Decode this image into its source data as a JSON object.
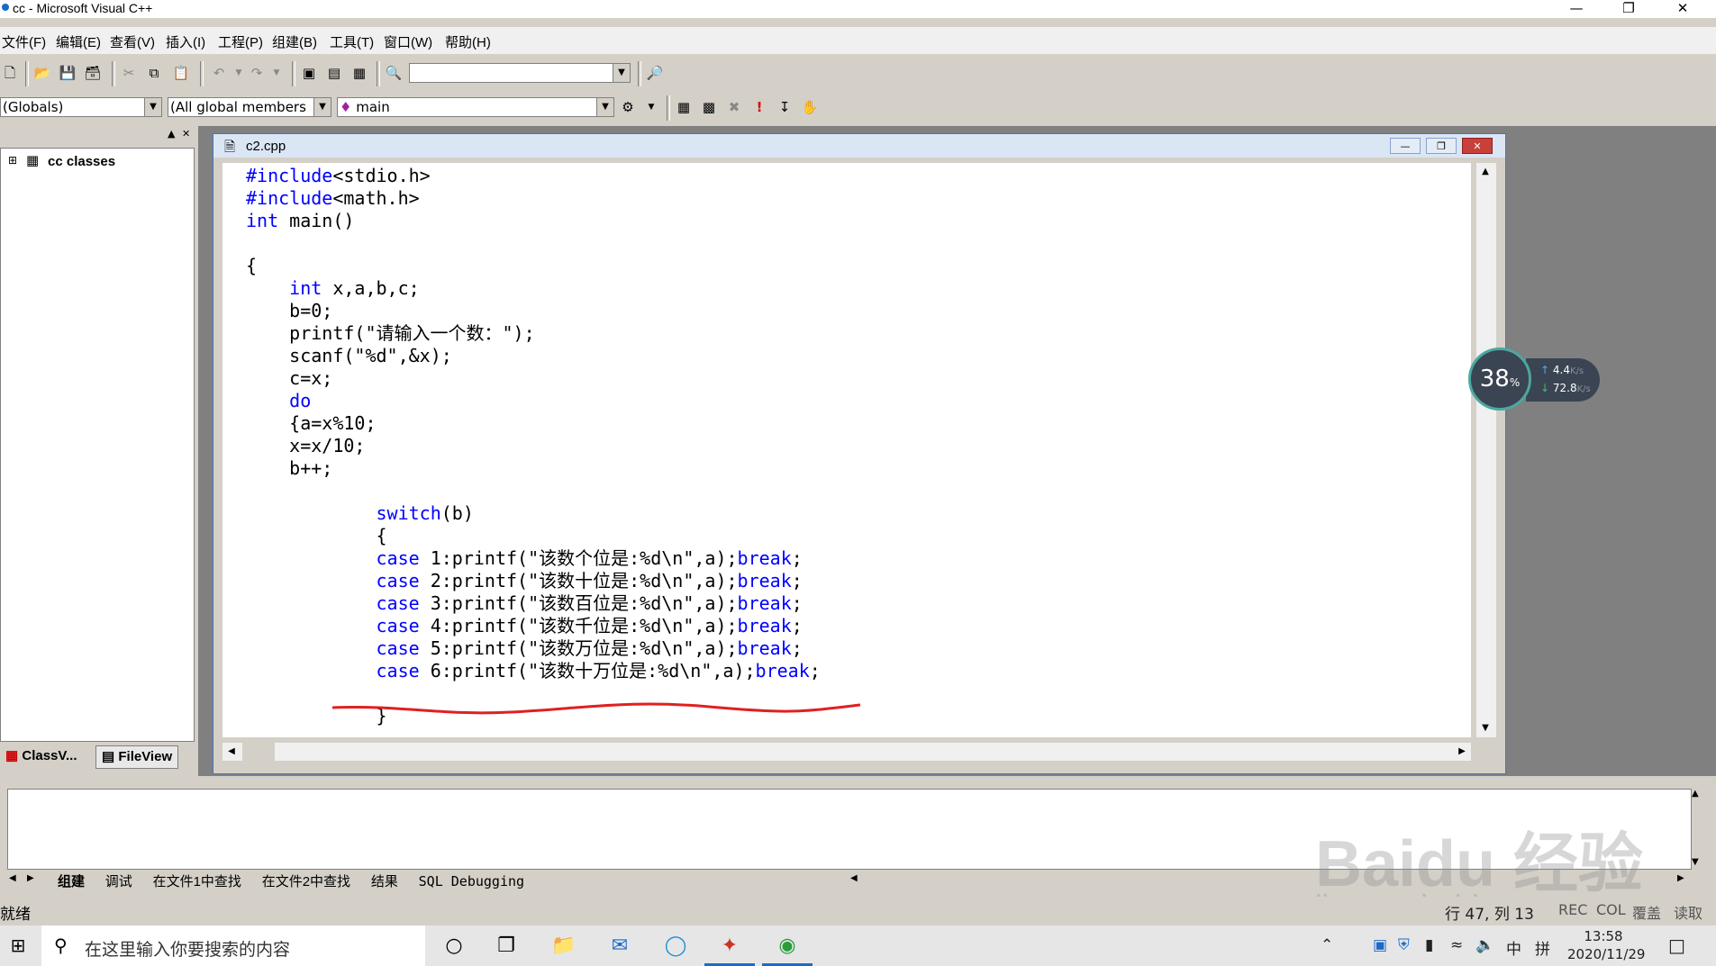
{
  "window": {
    "title": "cc - Microsoft Visual C++"
  },
  "menu": [
    "文件(F)",
    "编辑(E)",
    "查看(V)",
    "插入(I)",
    "工程(P)",
    "组建(B)",
    "工具(T)",
    "窗口(W)",
    "帮助(H)"
  ],
  "toolbar2": {
    "scope": "(Globals)",
    "members": "(All global members",
    "function": "main"
  },
  "workspace": {
    "tree_root": "cc classes",
    "tabs": [
      "ClassV...",
      "FileView"
    ]
  },
  "editor": {
    "doc_title": "c2.cpp",
    "lines": [
      "#include<stdio.h>",
      "#include<math.h>",
      "int main()",
      "",
      "{",
      "    int x,a,b,c;",
      "    b=0;",
      "    printf(\"请输入一个数：\");",
      "    scanf(\"%d\",&x);",
      "    c=x;",
      "    do",
      "    {a=x%10;",
      "    x=x/10;",
      "    b++;",
      "",
      "            switch(b)",
      "            {",
      "            case 1:printf(\"该数个位是:%d\\n\",a);break;",
      "            case 2:printf(\"该数十位是:%d\\n\",a);break;",
      "            case 3:printf(\"该数百位是:%d\\n\",a);break;",
      "            case 4:printf(\"该数千位是:%d\\n\",a);break;",
      "            case 5:printf(\"该数万位是:%d\\n\",a);break;",
      "            case 6:printf(\"该数十万位是:%d\\n\",a);break;",
      "",
      "            }"
    ]
  },
  "output": {
    "tabs": [
      "组建",
      "调试",
      "在文件1中查找",
      "在文件2中查找",
      "结果",
      "SQL Debugging"
    ]
  },
  "statusbar": {
    "text": "就绪",
    "position": "行 47, 列 13",
    "indicators": [
      "REC",
      "COL",
      "覆盖",
      "读取"
    ]
  },
  "network": {
    "percent": "38",
    "percent_unit": "%",
    "up": "4.4",
    "down": "72.8",
    "unit": "K/s"
  },
  "watermark": {
    "brand": "Baidu 经验",
    "url": "jingyan.baidu.com"
  },
  "taskbar": {
    "search_placeholder": "在这里输入你要搜索的内容",
    "time": "13:58",
    "date": "2020/11/29",
    "ime": "中",
    "ime2": "拼"
  },
  "colors": {
    "keyword": "#0000ff",
    "annotation": "#e02020"
  }
}
